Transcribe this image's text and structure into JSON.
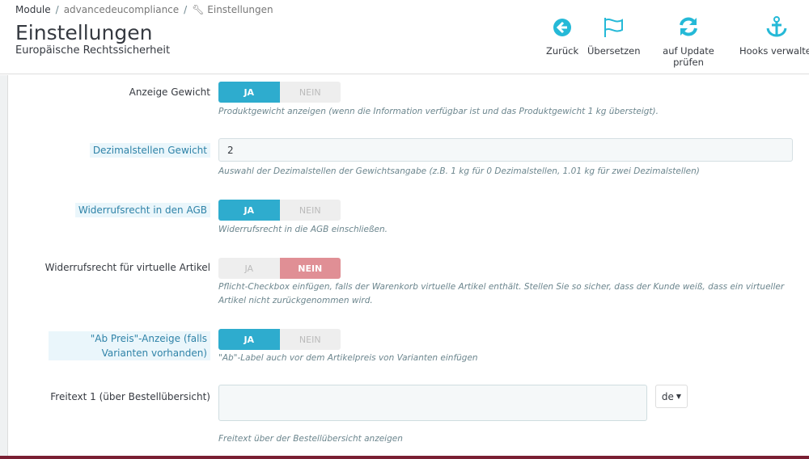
{
  "breadcrumb": [
    "Module",
    "advancedeucompliance",
    "Einstellungen"
  ],
  "header": {
    "title": "Einstellungen",
    "subtitle": "Europäische Rechtssicherheit"
  },
  "toolbar": [
    {
      "label": "Zurück",
      "icon": "arrow-circle-left-icon"
    },
    {
      "label": "Übersetzen",
      "icon": "flag-icon"
    },
    {
      "label": "auf Update prüfen",
      "icon": "refresh-icon"
    },
    {
      "label": "Hooks verwalten",
      "icon": "anchor-icon"
    }
  ],
  "colors": {
    "accent": "#25b9d7",
    "switch_on": "#2eacce",
    "switch_off": "#e08f95"
  },
  "fields": {
    "weight": {
      "label": "Anzeige Gewicht",
      "yes": "JA",
      "no": "NEIN",
      "value": "JA",
      "help": "Produktgewicht anzeigen (wenn die Information verfügbar ist und das Produktgewicht 1 kg übersteigt)."
    },
    "decimals": {
      "label": "Dezimalstellen Gewicht",
      "value": "2",
      "help": "Auswahl der Dezimalstellen der Gewichtsangabe (z.B. 1 kg für 0 Dezimalstellen, 1.01 kg für zwei Dezimalstellen)"
    },
    "agb": {
      "label": "Widerrufsrecht in den AGB",
      "yes": "JA",
      "no": "NEIN",
      "value": "JA",
      "help": "Widerrufsrecht in die AGB einschließen."
    },
    "virtual": {
      "label": "Widerrufsrecht für virtuelle Artikel",
      "yes": "JA",
      "no": "NEIN",
      "value": "NEIN",
      "help": "Pflicht-Checkbox einfügen, falls der Warenkorb virtuelle Artikel enthält. Stellen Sie so sicher, dass der Kunde weiß, dass ein virtueller Artikel nicht zurückgenommen wird."
    },
    "abpreis": {
      "label": "\"Ab Preis\"-Anzeige (falls Varianten vorhanden)",
      "yes": "JA",
      "no": "NEIN",
      "value": "JA",
      "help": "\"Ab\"-Label auch vor dem Artikelpreis von Varianten einfügen"
    },
    "freitext": {
      "label": "Freitext 1 (über Bestellübersicht)",
      "value": "",
      "lang": "de",
      "help": "Freitext über der Bestellübersicht anzeigen"
    }
  }
}
